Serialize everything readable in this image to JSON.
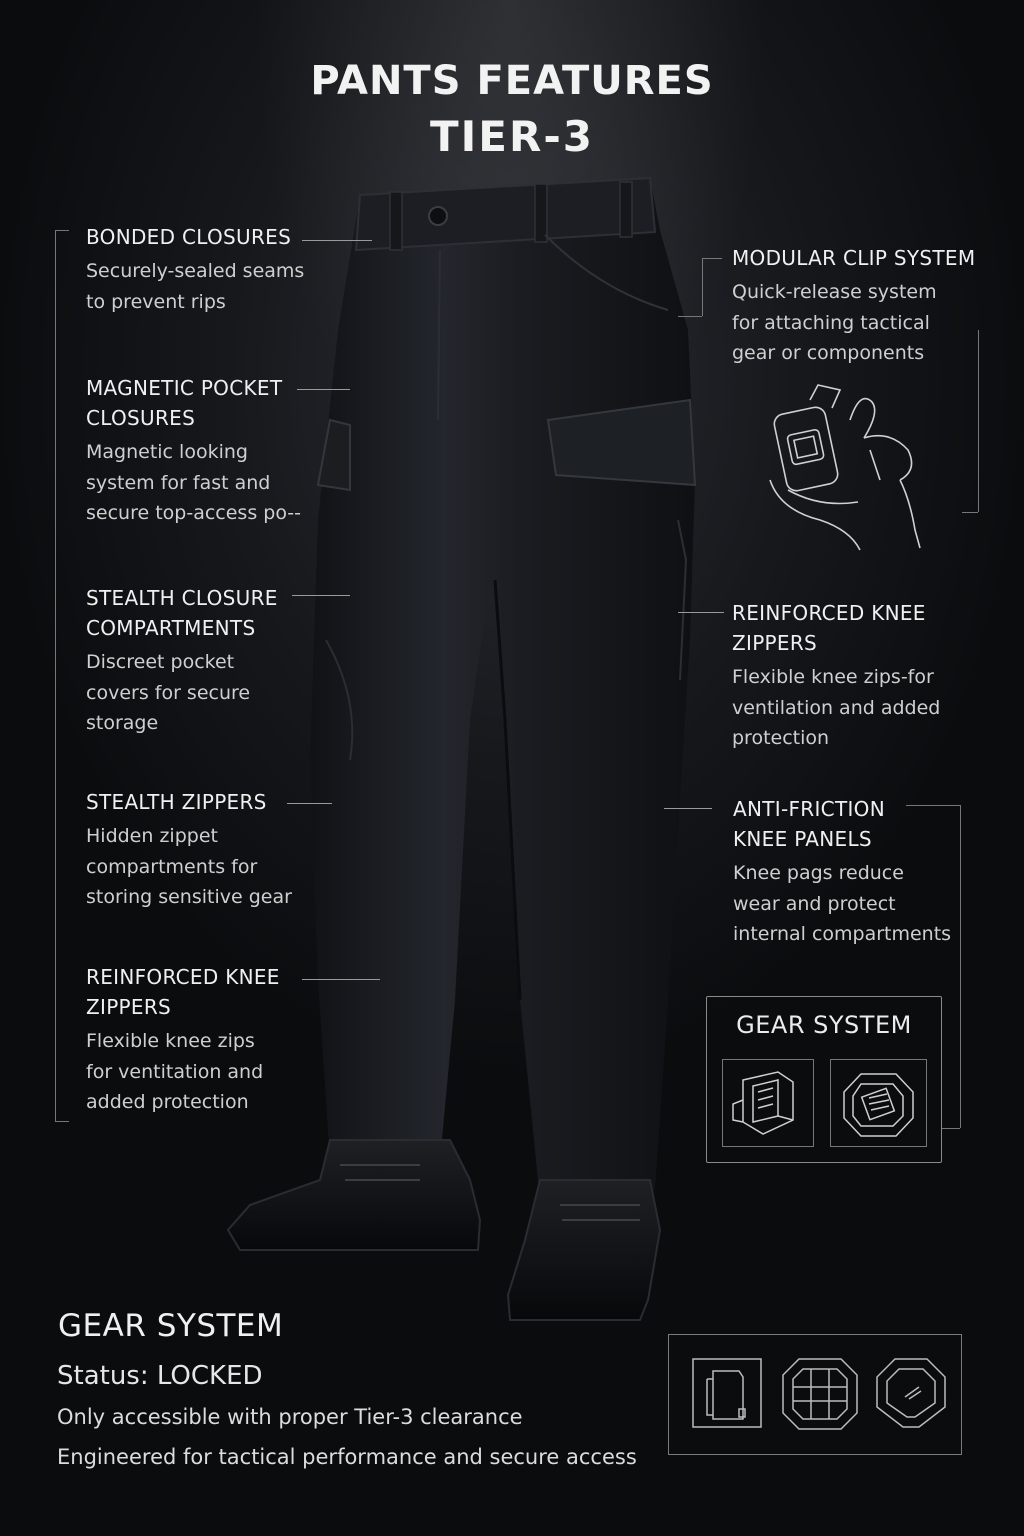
{
  "title": {
    "line1": "PANTS FEATURES",
    "line2": "TIER-3"
  },
  "left_features": [
    {
      "title": "BONDED CLOSURES",
      "desc": [
        "Securely-sealed seams",
        "to prevent rips"
      ]
    },
    {
      "title": "MAGNETIC POCKET",
      "title2": "CLOSURES",
      "desc": [
        "Magnetic looking",
        "system for fast and",
        "secure top-access po--"
      ]
    },
    {
      "title": "STEALTH CLOSURE",
      "title2": "COMPARTMENTS",
      "desc": [
        "Discreet pocket",
        "covers for secure",
        "storage"
      ]
    },
    {
      "title": "STEALTH ZIPPERS",
      "desc": [
        "Hidden zippet",
        "compartments for",
        "storing sensitive gear"
      ]
    },
    {
      "title": "REINFORCED KNEE",
      "title2": "ZIPPERS",
      "desc": [
        "Flexible knee zips",
        "for ventitation and",
        "added protection"
      ]
    }
  ],
  "right_features": [
    {
      "title": "MODULAR CLIP SYSTEM",
      "desc": [
        "Quick-release system",
        "for attaching tactical",
        "gear or components"
      ]
    },
    {
      "title": "REINFORCED KNEE",
      "title2": "ZIPPERS",
      "desc": [
        "Flexible knee zips-for",
        "ventilation and added",
        "protection"
      ]
    },
    {
      "title": "ANTI-FRICTION",
      "title2": "KNEE PANELS",
      "desc": [
        "Knee pags reduce",
        "wear and protect",
        "internal compartments"
      ]
    }
  ],
  "gear_box": {
    "title": "GEAR SYSTEM"
  },
  "bottom": {
    "title": "GEAR SYSTEM",
    "status": "Status:  LOCKED",
    "line1": "Only accessible with proper Tier-3 clearance",
    "line2": "Engineered for tactical performance and secure access"
  },
  "icons": [
    "clip-hand-icon",
    "clip-module-icon",
    "shield-module-icon",
    "panel-icon",
    "grid-plate-icon",
    "shield-badge-icon"
  ],
  "colors": {
    "background": "#121418",
    "text": "#e6e6e6",
    "pants": "#1b1d22",
    "lines": "#8a8a8a"
  }
}
